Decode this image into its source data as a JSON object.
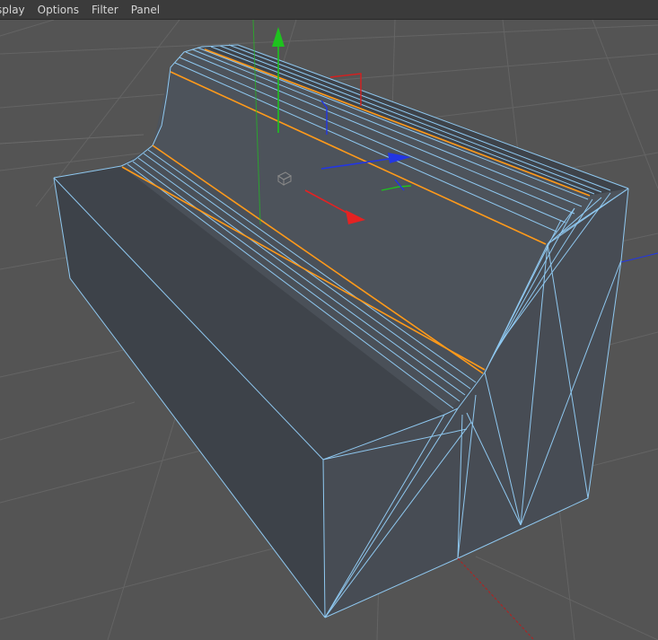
{
  "menubar": {
    "items": [
      {
        "label": "splay"
      },
      {
        "label": "Options"
      },
      {
        "label": "Filter"
      },
      {
        "label": "Panel"
      }
    ]
  },
  "viewport": {
    "background_color": "#545454",
    "grid_color": "#636363",
    "object": {
      "name_hint": "sofa-mesh",
      "face_color_top": "#4b5159",
      "face_color_side": "#3e434a",
      "face_color_back": "#474c53",
      "wire_color": "#8fc8f0",
      "selected_edge_color": "#ff9a1a"
    },
    "gizmo": {
      "x_axis_color": "#e52222",
      "y_axis_color": "#1ec21e",
      "z_axis_color": "#2236e5"
    }
  }
}
